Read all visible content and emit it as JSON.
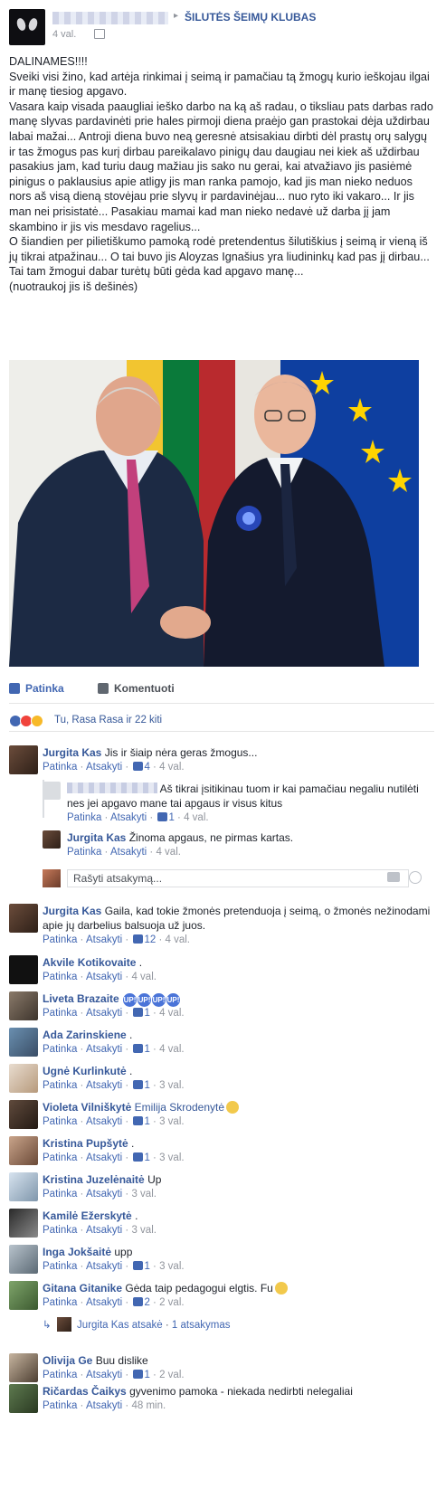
{
  "header": {
    "author_blurred": "",
    "group_name": "ŠILUTĖS ŠEIMŲ KLUBAS",
    "time": "4 val.",
    "arrow": "▸"
  },
  "post": {
    "paragraphs": [
      "DALINAMES!!!!",
      "Sveiki visi žino, kad artėja rinkimai į seimą ir pamačiau tą žmogų kurio ieškojau ilgai ir manę tiesiog apgavo.",
      "Vasara kaip visada paaugliai ieško darbo na ką aš radau, o tiksliau pats darbas rado manę slyvas pardavinėti prie hales pirmoji diena praėjo gan prastokai dėja uždirbau labai mažai... Antroji diena buvo neą geresnė atsisakiau dirbti dėl prastų orų salygų ir tas žmogus pas kurį dirbau pareikalavo pinigų dau daugiau nei kiek aš uždirbau pasakius jam, kad turiu daug mažiau jis sako nu gerai, kai atvažiavo jis pasiėmė pinigus o paklausius apie atligy jis man ranka pamojo, kad jis man nieko neduos nors aš visą dieną stovėjau prie slyvų ir pardavinėjau... nuo ryto iki vakaro... Ir jis man nei prisistatė... Pasakiau mamai kad man nieko nedavė už darba jį jam skambino ir jis vis mesdavo ragelius...",
      "O šiandien per pilietiškumo pamoką rodė pretendentus šilutiškius į seimą ir vieną iš jų tikrai atpažinau... O tai buvo jis Aloyzas Ignašius yra liudininkų kad pas jį dirbau... Tai tam žmogui dabar turėtų būti gėda kad apgavo manę...",
      "(nuotraukoj jis iš dešinės)"
    ]
  },
  "actions": {
    "like": "Patinka",
    "comment": "Komentuoti"
  },
  "reactions": {
    "summary": "Tu, Rasa Rasa ir 22 kiti",
    "colors": [
      "#4267b2",
      "#f0433b",
      "#f7b928"
    ]
  },
  "meta_labels": {
    "like": "Patinka",
    "reply": "Atsakyti",
    "sep": "·"
  },
  "comments": [
    {
      "name": "Jurgita Kas",
      "text": "Jis ir šiaip nėra geras žmogus...",
      "likes": "4",
      "time": "4 val."
    },
    {
      "name": "Jurgita Kas",
      "text": "Gaila, kad tokie žmonės pretenduoja į seimą, o žmonės nežinodami apie jų darbelius balsuoja už juos.",
      "likes": "12",
      "time": "4 val."
    },
    {
      "name": "Akvile Kotikovaite",
      "text": ".",
      "likes": "",
      "time": "4 val."
    },
    {
      "name": "Liveta Brazaite",
      "text": "",
      "badges": [
        "UP!",
        "UP!",
        "UP!",
        "UP!"
      ],
      "likes": "1",
      "time": "4 val."
    },
    {
      "name": "Ada Zarinskiene",
      "text": ".",
      "likes": "1",
      "time": "4 val."
    },
    {
      "name": "Ugnė Kurlinkutė",
      "text": ".",
      "likes": "1",
      "time": "3 val."
    },
    {
      "name": "Violeta Vilniškytė",
      "text": "Emilija Skrodenytė",
      "likes": "1",
      "time": "3 val."
    },
    {
      "name": "Kristina Pupšytė",
      "text": ".",
      "likes": "1",
      "time": "3 val."
    },
    {
      "name": "Kristina Juzelėnaitė",
      "text": "Up",
      "likes": "",
      "time": "3 val."
    },
    {
      "name": "Kamilė Ežerskytė",
      "text": ".",
      "likes": "",
      "time": "3 val."
    },
    {
      "name": "Inga Jokšaitė",
      "text": "upp",
      "likes": "1",
      "time": "3 val."
    },
    {
      "name": "Gitana Gitanike",
      "text": "Gėda taip pedagogui elgtis. Fu",
      "likes": "2",
      "time": "2 val."
    },
    {
      "name": "Olivija Ge",
      "text": "Buu dislike",
      "likes": "1",
      "time": "2 val."
    },
    {
      "name": "Ričardas Čaikys",
      "text": "gyvenimo pamoka - niekada nedirbti nelegaliai",
      "likes": "",
      "time": "48 min."
    }
  ],
  "replies": [
    {
      "name": "",
      "text": "Aš tikrai įsitikinau tuom ir kai pamačiau negaliu nutilėti nes jei apgavo mane tai apgaus ir visus kitus",
      "likes": "1",
      "time": "4 val."
    },
    {
      "name": "Jurgita Kas",
      "text": "Žinoma apgaus, ne pirmas kartas.",
      "likes": "",
      "time": "4 val."
    }
  ],
  "reply_box": {
    "placeholder": "Rašyti atsakymą..."
  },
  "more_replies": {
    "name": "Jurgita Kas",
    "action": "atsakė",
    "count": "1 atsakymas"
  }
}
